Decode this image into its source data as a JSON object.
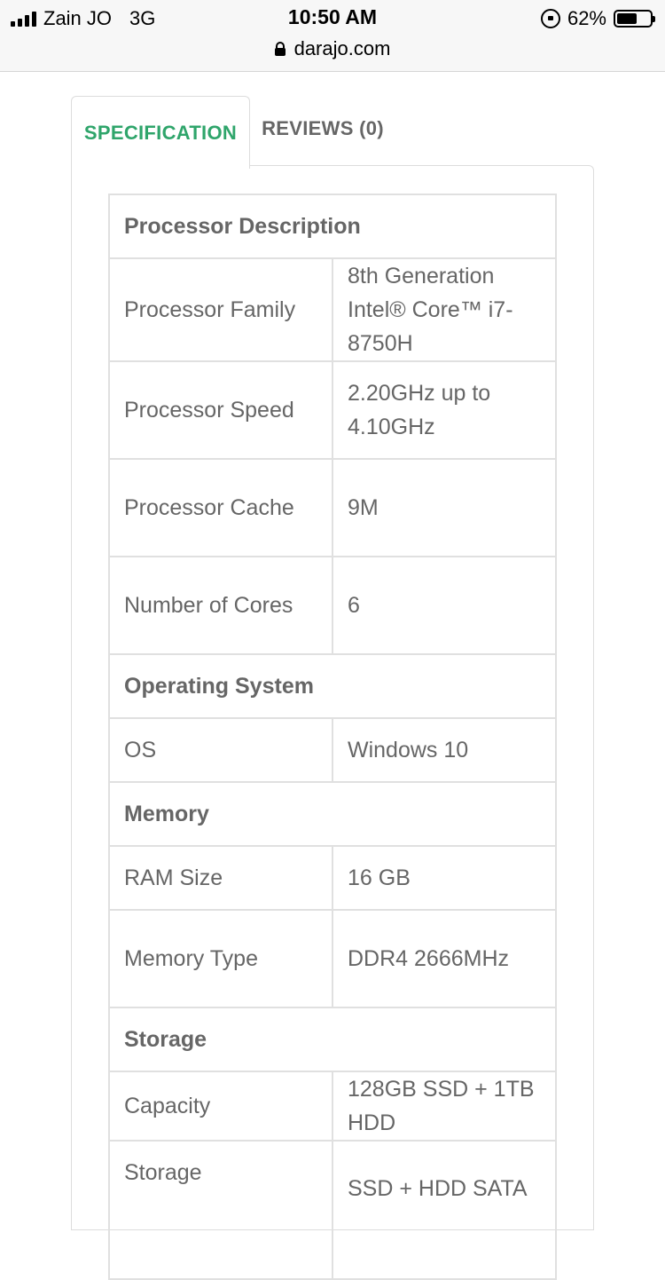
{
  "status_bar": {
    "carrier": "Zain JO",
    "network": "3G",
    "time": "10:50 AM",
    "battery_percent": "62%",
    "battery_level": 0.62
  },
  "browser": {
    "url": "darajo.com"
  },
  "tabs": {
    "specification": "SPECIFICATION",
    "reviews": "REVIEWS (0)",
    "active_color": "#2fa56b"
  },
  "specs": {
    "processor_heading": "Processor Description",
    "processor_family_label": "Processor Family",
    "processor_family_value": "8th Generation Intel® Core™ i7-8750H",
    "processor_speed_label": "Processor Speed",
    "processor_speed_value": "2.20GHz up to 4.10GHz",
    "processor_cache_label": "Processor Cache",
    "processor_cache_value": "9M",
    "cores_label": "Number of Cores",
    "cores_value": "6",
    "os_heading": "Operating System",
    "os_label": "OS",
    "os_value": "Windows 10",
    "memory_heading": "Memory",
    "ram_label": "RAM Size",
    "ram_value": "16 GB",
    "memory_type_label": "Memory Type",
    "memory_type_value": "DDR4 2666MHz",
    "storage_heading": "Storage",
    "capacity_label": "Capacity",
    "capacity_value": "128GB SSD + 1TB HDD",
    "storage_type_label": "Storage",
    "storage_type_value": "SSD + HDD SATA"
  }
}
